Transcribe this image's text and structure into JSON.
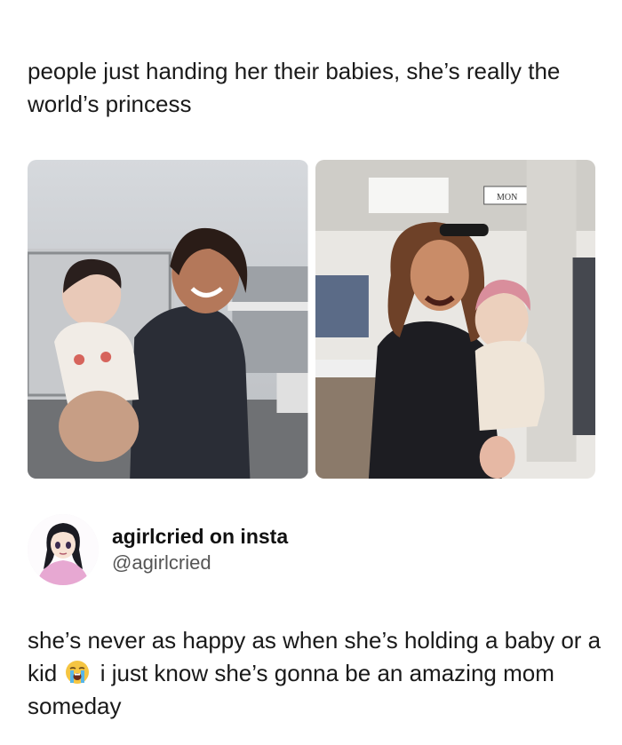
{
  "post": {
    "caption": "people just handing her their babies, she’s really the world’s princess",
    "photos": [
      {
        "label": "photo-left"
      },
      {
        "label": "photo-right",
        "store_sign": "MON"
      }
    ]
  },
  "tweet": {
    "display_name": "agirlcried on insta",
    "handle": "@agirlcried",
    "text_before_emoji": "she’s never as happy as when she’s holding a baby or a kid",
    "emoji": "loudly-crying-face-icon",
    "text_after_emoji": "i just know she’s gonna be an amazing mom someday"
  },
  "colors": {
    "background": "#ffffff",
    "text": "#1a1a1a",
    "handle": "#555555",
    "avatar_pink": "#e7a8d2"
  }
}
